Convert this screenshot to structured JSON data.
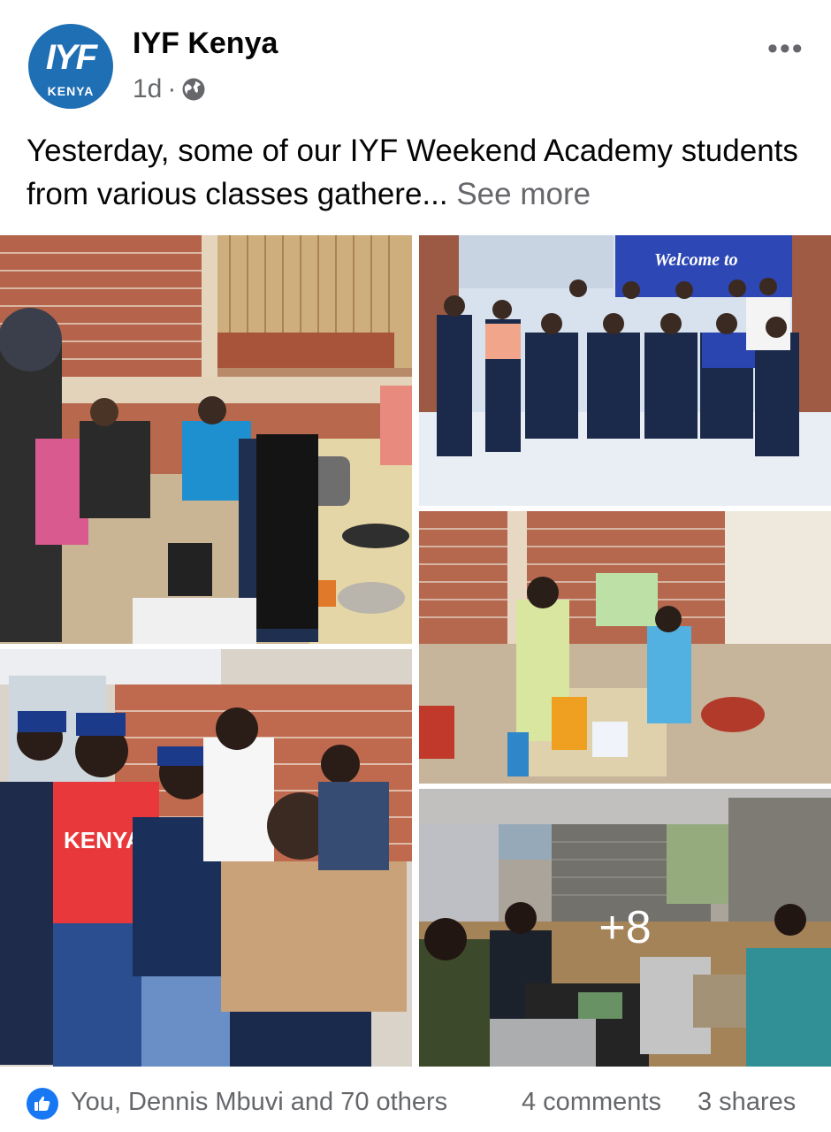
{
  "post": {
    "page_name": "IYF Kenya",
    "avatar": {
      "logo_text": "IYF",
      "logo_subtext": "KENYA"
    },
    "time": "1d",
    "separator": "·",
    "audience_icon": "globe-icon",
    "more_icon": "more-dots-icon",
    "more_label": "•••",
    "caption_text": "Yesterday, some of our IYF Weekend Academy students from various classes gathere...",
    "see_more_label": "See more"
  },
  "photos": {
    "banner_text": "Welcome to",
    "kenya_shirt_text": "KENYA",
    "more_count": "+8"
  },
  "reactions": {
    "like_icon": "thumbs-up-icon",
    "reactors_text": "You, Dennis Mbuvi and 70 others",
    "comments_text": "4 comments",
    "shares_text": "3 shares"
  },
  "colors": {
    "brand_blue": "#1877f2",
    "muted_text": "#65676b",
    "avatar_blue": "#1f6fb5"
  }
}
